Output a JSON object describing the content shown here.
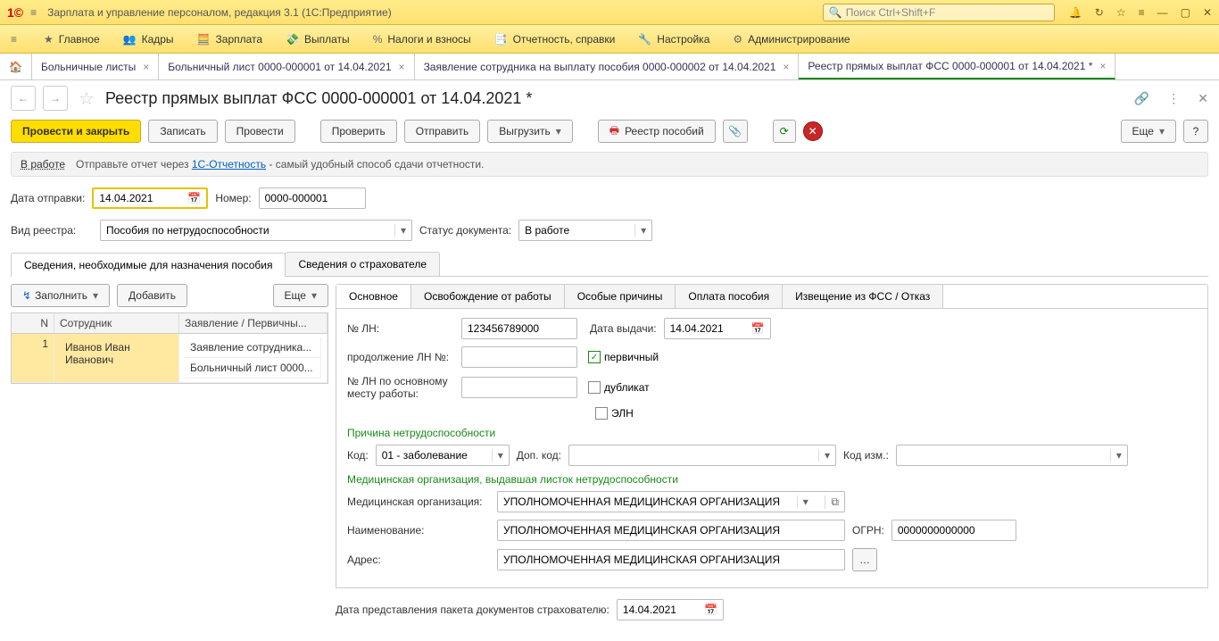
{
  "titlebar": {
    "app_title": "Зарплата и управление персоналом, редакция 3.1  (1С:Предприятие)",
    "search_placeholder": "Поиск Ctrl+Shift+F"
  },
  "mainmenu": {
    "items": [
      "Главное",
      "Кадры",
      "Зарплата",
      "Выплаты",
      "Налоги и взносы",
      "Отчетность, справки",
      "Настройка",
      "Администрирование"
    ]
  },
  "tabs": {
    "items": [
      {
        "label": "Больничные листы"
      },
      {
        "label": "Больничный лист 0000-000001 от 14.04.2021"
      },
      {
        "label": "Заявление сотрудника на выплату пособия 0000-000002 от 14.04.2021"
      },
      {
        "label": "Реестр прямых выплат ФСС 0000-000001 от 14.04.2021 *",
        "active": true
      }
    ]
  },
  "doc": {
    "title": "Реестр прямых выплат ФСС 0000-000001 от 14.04.2021 *"
  },
  "actions": {
    "post_close": "Провести и закрыть",
    "write": "Записать",
    "post": "Провести",
    "check": "Проверить",
    "send": "Отправить",
    "export": "Выгрузить",
    "registry": "Реестр пособий",
    "more": "Еще"
  },
  "status": {
    "label": "В работе",
    "hint_pre": "Отправьте отчет через ",
    "hint_link": "1С-Отчетность",
    "hint_post": " - самый удобный способ сдачи отчетности."
  },
  "header_fields": {
    "date_label": "Дата отправки:",
    "date_value": "14.04.2021",
    "number_label": "Номер:",
    "number_value": "0000-000001",
    "reg_type_label": "Вид реестра:",
    "reg_type_value": "Пособия по нетрудоспособности",
    "doc_status_label": "Статус документа:",
    "doc_status_value": "В работе"
  },
  "inner_tabs": {
    "t1": "Сведения, необходимые для назначения пособия",
    "t2": "Сведения о страхователе"
  },
  "left": {
    "fill": "Заполнить",
    "add": "Добавить",
    "more": "Еще",
    "col_n": "N",
    "col_emp": "Сотрудник",
    "col_doc": "Заявление / Первичны...",
    "rows": [
      {
        "n": "1",
        "emp": "Иванов Иван Иванович",
        "doc1": "Заявление сотрудника...",
        "doc2": "Больничный лист 0000..."
      }
    ]
  },
  "sub_tabs": [
    "Основное",
    "Освобождение от работы",
    "Особые причины",
    "Оплата пособия",
    "Извещение из ФСС / Отказ"
  ],
  "main_panel": {
    "ln_label": "№ ЛН:",
    "ln_value": "123456789000",
    "issue_date_label": "Дата выдачи:",
    "issue_date_value": "14.04.2021",
    "cont_label": "продолжение ЛН №:",
    "primary": "первичный",
    "duplicate": "дубликат",
    "eln": "ЭЛН",
    "ln_main_label": "№ ЛН по основному месту работы:",
    "cause_header": "Причина нетрудоспособности",
    "code_label": "Код:",
    "code_value": "01 - заболевание",
    "add_code_label": "Доп. код:",
    "code_change_label": "Код изм.:",
    "med_header": "Медицинская организация, выдавшая листок нетрудоспособности",
    "med_org_label": "Медицинская организация:",
    "med_org_value": "УПОЛНОМОЧЕННАЯ МЕДИЦИНСКАЯ ОРГАНИЗАЦИЯ",
    "name_label": "Наименование:",
    "name_value": "УПОЛНОМОЧЕННАЯ МЕДИЦИНСКАЯ ОРГАНИЗАЦИЯ",
    "ogrn_label": "ОГРН:",
    "ogrn_value": "0000000000000",
    "addr_label": "Адрес:",
    "addr_value": "УПОЛНОМОЧЕННАЯ МЕДИЦИНСКАЯ ОРГАНИЗАЦИЯ",
    "pack_date_label": "Дата представления пакета документов страхователю:",
    "pack_date_value": "14.04.2021"
  }
}
